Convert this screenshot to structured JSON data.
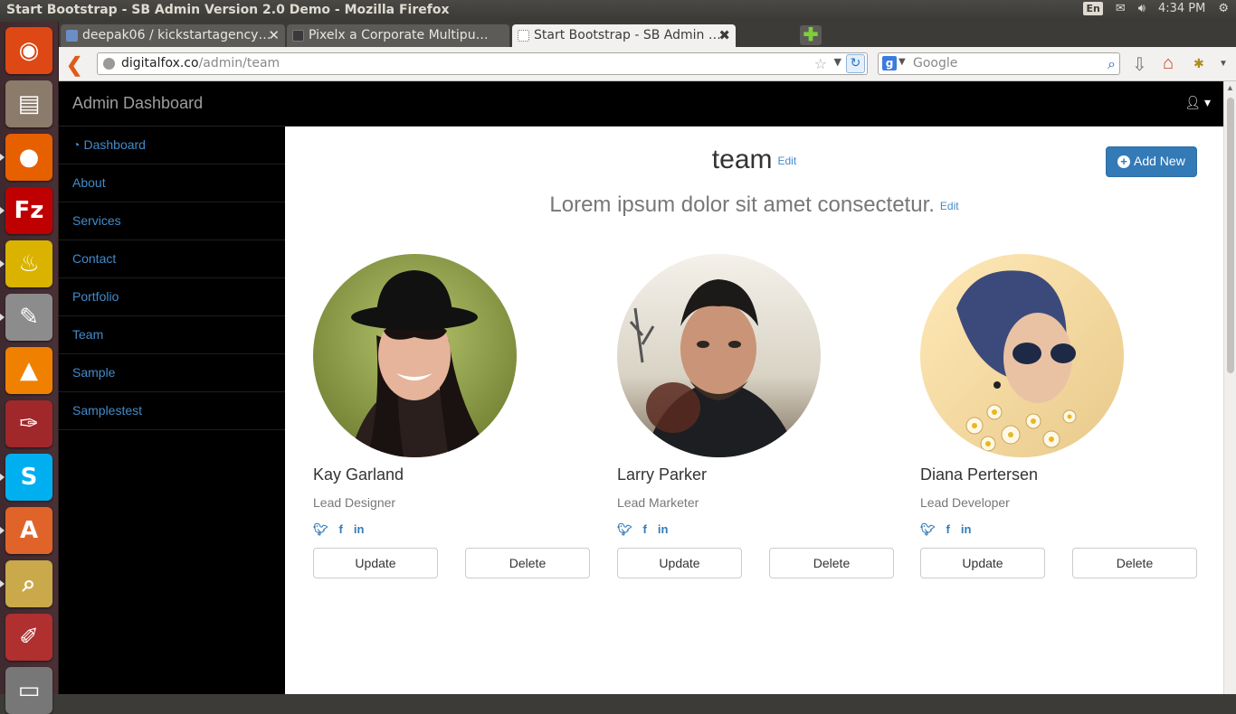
{
  "os_panel": {
    "window_title": "Start Bootstrap - SB Admin Version 2.0 Demo - Mozilla Firefox",
    "keyboard_layout": "En",
    "clock": "4:34 PM"
  },
  "launcher": {
    "items": [
      {
        "name": "ubuntu-home-icon",
        "glyph": "◉",
        "color": "#dd4814"
      },
      {
        "name": "files-icon",
        "glyph": "▤",
        "color": "#8a7b6a"
      },
      {
        "name": "firefox-icon",
        "glyph": "●",
        "color": "#e66000"
      },
      {
        "name": "filezilla-icon",
        "glyph": "Fz",
        "color": "#bf0000"
      },
      {
        "name": "teapot-icon",
        "glyph": "♨",
        "color": "#d9b300"
      },
      {
        "name": "settings-window-icon",
        "glyph": "✎",
        "color": "#8c8c8c"
      },
      {
        "name": "vlc-icon",
        "glyph": "▲",
        "color": "#f08000"
      },
      {
        "name": "color-picker-icon",
        "glyph": "✑",
        "color": "#a0282a"
      },
      {
        "name": "skype-icon",
        "glyph": "S",
        "color": "#00aff0"
      },
      {
        "name": "software-center-icon",
        "glyph": "A",
        "color": "#e0642a"
      },
      {
        "name": "image-viewer-icon",
        "glyph": "⌕",
        "color": "#c9a94a"
      },
      {
        "name": "paint-icon",
        "glyph": "✐",
        "color": "#b03030"
      },
      {
        "name": "trash-icon",
        "glyph": "▭",
        "color": "#777777"
      }
    ]
  },
  "browser": {
    "tabs": [
      {
        "label": "deepak06 / kickstartagency…",
        "active": false
      },
      {
        "label": "Pixelx a Corporate Multipu…",
        "active": false
      },
      {
        "label": "Start Bootstrap - SB Admin …",
        "active": true
      }
    ],
    "url_host": "digitalfox.co",
    "url_path": "/admin/team",
    "search_placeholder": "Google",
    "search_engine_badge": "g"
  },
  "admin": {
    "brand": "Admin Dashboard",
    "sidebar": [
      {
        "label": "Dashboard"
      },
      {
        "label": "About"
      },
      {
        "label": "Services"
      },
      {
        "label": "Contact"
      },
      {
        "label": "Portfolio"
      },
      {
        "label": "Team"
      },
      {
        "label": "Sample"
      },
      {
        "label": "Samplestest"
      }
    ],
    "page_title": "team",
    "page_subtitle": "Lorem ipsum dolor sit amet consectetur.",
    "edit_label": "Edit",
    "add_new_label": "Add New",
    "update_label": "Update",
    "delete_label": "Delete",
    "accent_color": "#337ab7",
    "team": [
      {
        "name": "Kay Garland",
        "role": "Lead Designer"
      },
      {
        "name": "Larry Parker",
        "role": "Lead Marketer"
      },
      {
        "name": "Diana Pertersen",
        "role": "Lead Developer"
      }
    ]
  }
}
